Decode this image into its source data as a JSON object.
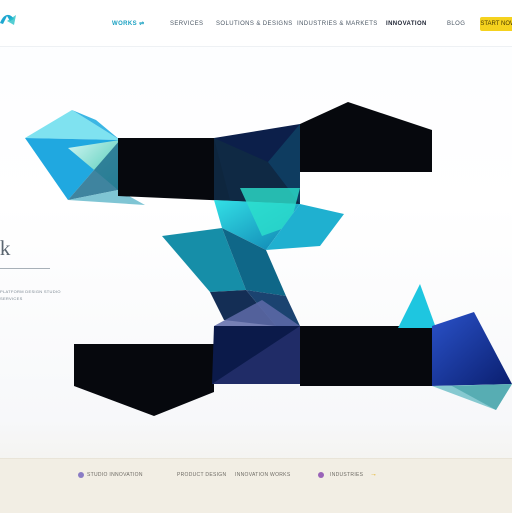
{
  "header": {
    "logo_icon": "brand-logo-icon",
    "nav": [
      {
        "label": "WORKS ⇌"
      },
      {
        "label": "SERVICES"
      },
      {
        "label": "SOLUTIONS & DESIGNS"
      },
      {
        "label": "INDUSTRIES & MARKETS"
      },
      {
        "label": "INNOVATION"
      },
      {
        "label": "BLOG"
      }
    ],
    "cta_label": "START NOW"
  },
  "hero": {
    "title": "lk",
    "subtitle_lines": [
      "PLATFORM DESIGN STUDIO",
      "SERVICES"
    ]
  },
  "footer": {
    "items": [
      {
        "label": "STUDIO INNOVATION"
      },
      {
        "label": "PRODUCT DESIGN"
      },
      {
        "label": "INNOVATION WORKS"
      },
      {
        "label": "INDUSTRIES"
      }
    ],
    "arrow": "→"
  },
  "colors": {
    "accent": "#1aa1c2",
    "cta": "#f5d21e",
    "teal": "#1ab3c9",
    "navy": "#0b1a4a",
    "footer_bg": "#f2eee4"
  }
}
